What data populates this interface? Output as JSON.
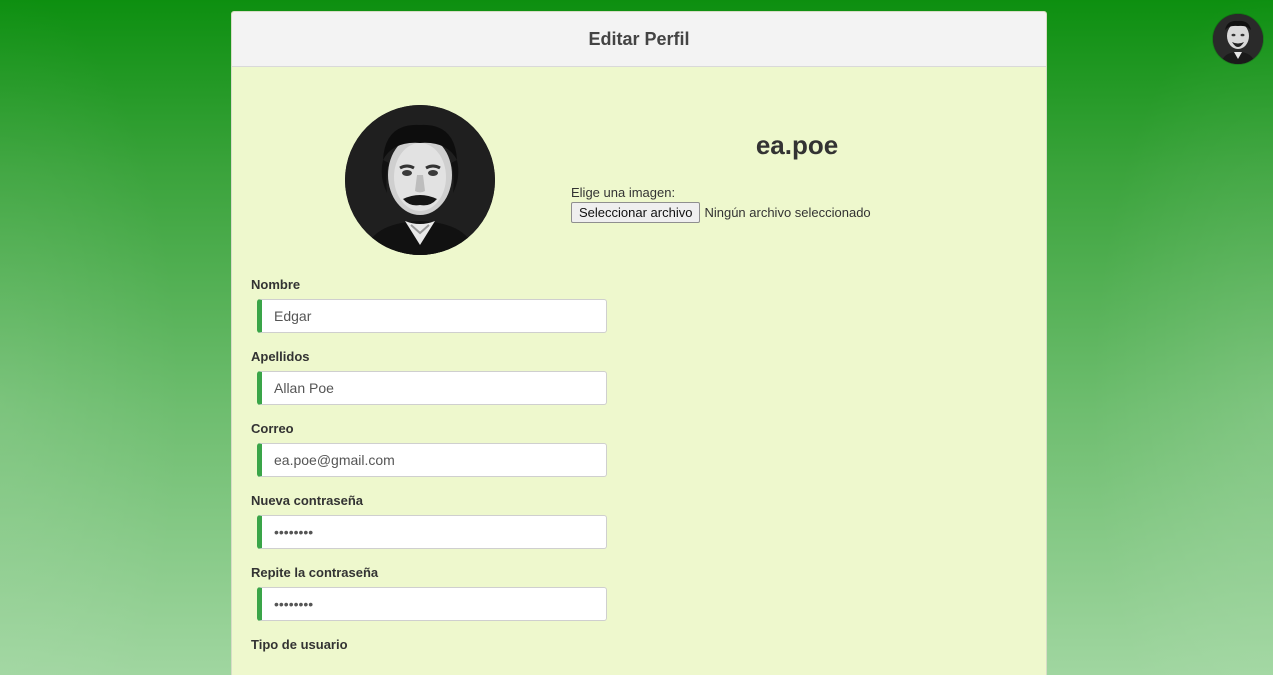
{
  "header": {
    "title": "Editar Perfil"
  },
  "profile": {
    "username": "ea.poe",
    "photo_icon": "user-portrait-photo"
  },
  "file_upload": {
    "label": "Elige una imagen:",
    "button_label": "Seleccionar archivo",
    "status": "Ningún archivo seleccionado"
  },
  "form": {
    "nombre": {
      "label": "Nombre",
      "value": "Edgar"
    },
    "apellidos": {
      "label": "Apellidos",
      "value": "Allan Poe"
    },
    "correo": {
      "label": "Correo",
      "value": "ea.poe@gmail.com"
    },
    "nueva_contrasena": {
      "label": "Nueva contraseña",
      "value": "••••••••"
    },
    "repite_contrasena": {
      "label": "Repite la contraseña",
      "value": "••••••••"
    },
    "tipo_usuario": {
      "label": "Tipo de usuario"
    }
  },
  "colors": {
    "accent": "#3aa548",
    "panel_bg": "#eef8cd",
    "header_bg": "#f3f3f3",
    "page_bg_top": "#0d8f10"
  }
}
